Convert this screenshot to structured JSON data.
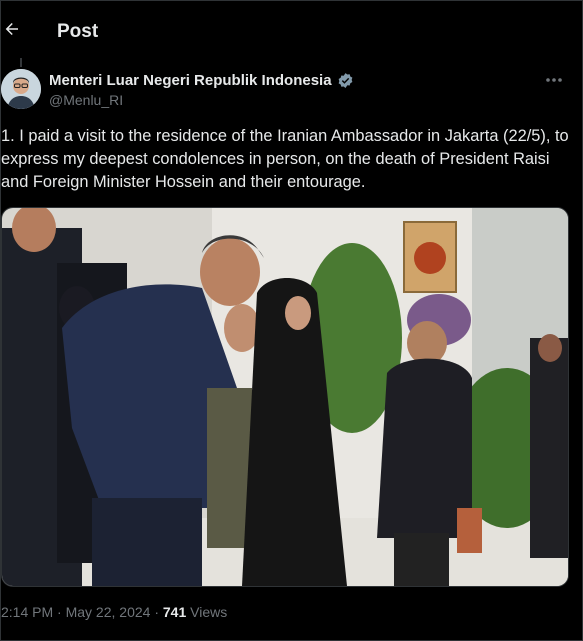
{
  "header": {
    "title": "Post"
  },
  "author": {
    "name": "Menteri Luar Negeri Republik Indonesia",
    "handle": "@Menlu_RI"
  },
  "tweet": {
    "text": "1. I paid a visit to the residence of the Iranian Ambassador in Jakarta (22/5), to express my deepest condolences in person, on the death of President Raisi and Foreign Minister Hossein and their entourage."
  },
  "meta": {
    "time": "2:14 PM",
    "sep1": " · ",
    "date": "May 22, 2024",
    "sep2": " · ",
    "views_count": "741",
    "views_label": " Views"
  },
  "colors": {
    "background": "#000000",
    "text": "#e7e9ea",
    "secondary": "#71767b",
    "verified": "#829aab",
    "border": "#2f3336"
  },
  "icons": {
    "back": "arrow-left-icon",
    "verified": "verified-badge-icon",
    "more": "more-horizontal-icon"
  }
}
